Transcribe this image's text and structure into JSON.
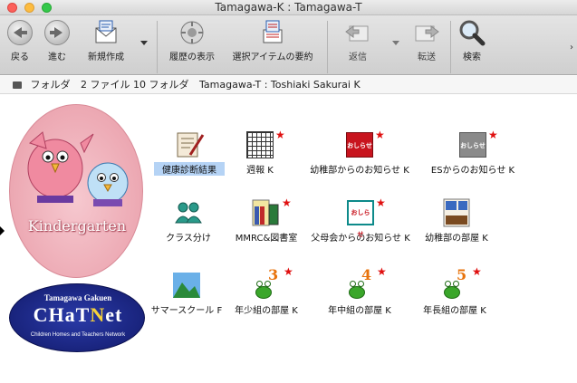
{
  "window": {
    "title": "Tamagawa-K : Tamagawa-T"
  },
  "toolbar": {
    "back": "戻る",
    "forward": "進む",
    "compose": "新規作成",
    "history": "履歴の表示",
    "summary": "選択アイテムの要約",
    "reply": "返信",
    "forward_msg": "転送",
    "search": "検索",
    "overflow": "›"
  },
  "pathbar": {
    "folder": "フォルダ",
    "count": "2 ファイル 10 フォルダ",
    "path": "Tamagawa-T : Toshiaki Sakurai K"
  },
  "logos": {
    "kindergarten": "Kindergarten",
    "chatnet_top": "Tamagawa Gakuen",
    "chatnet_c1": "CHaT",
    "chatnet_c2": "N",
    "chatnet_c3": "et",
    "chatnet_bottom": "Children Homes and Teachers Network"
  },
  "items": {
    "health": "健康診断結果",
    "weekly": "週報 K",
    "kinder_news": "幼稚部からのお知らせ K",
    "es_news": "ESからのお知らせ K",
    "class": "クラス分け",
    "mmrc": "MMRC&図書室",
    "parents_news": "父母会からのお知らせ K",
    "kinder_room": "幼稚部の部屋 K",
    "summer": "サマースクール F",
    "nensho": "年少組の部屋 K",
    "nenchu": "年中組の部屋 K",
    "nencho": "年長組の部屋 K"
  },
  "icons": {
    "notice": "おしらせ",
    "n3": "3",
    "n4": "4",
    "n5": "5",
    "star": "★"
  }
}
